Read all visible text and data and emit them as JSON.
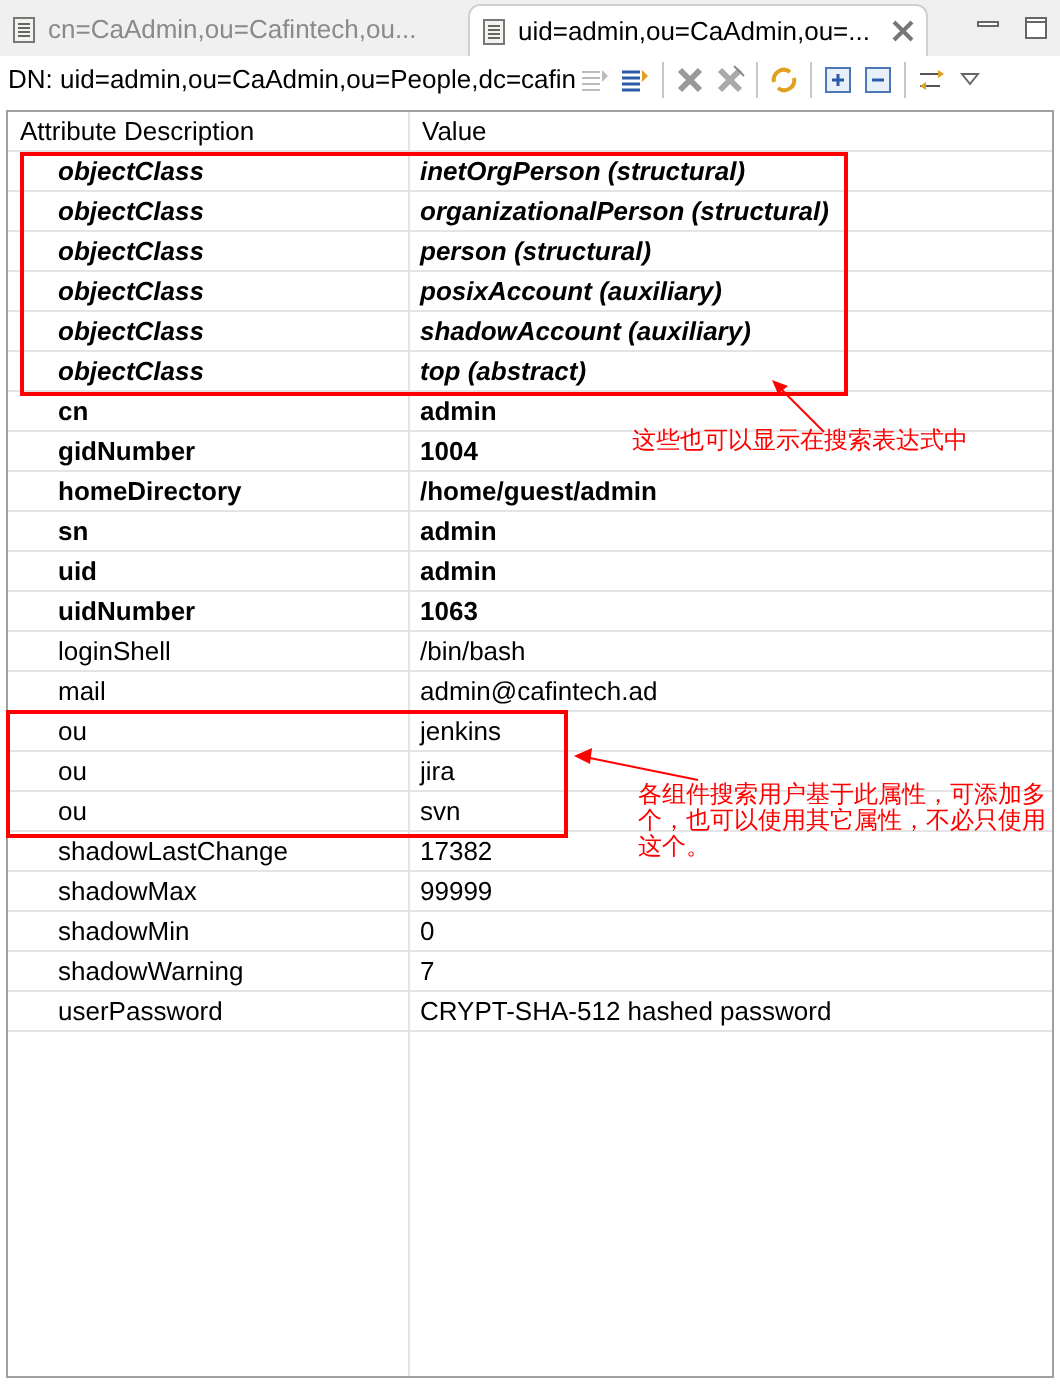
{
  "tabs": [
    {
      "label": "cn=CaAdmin,ou=Cafintech,ou...",
      "selected": false
    },
    {
      "label": "uid=admin,ou=CaAdmin,ou=...",
      "selected": true
    }
  ],
  "dn": "DN: uid=admin,ou=CaAdmin,ou=People,dc=cafin",
  "table": {
    "columns": [
      "Attribute Description",
      "Value"
    ],
    "rows": [
      {
        "kind": "objectclass",
        "attribute": "objectClass",
        "value": "inetOrgPerson (structural)"
      },
      {
        "kind": "objectclass",
        "attribute": "objectClass",
        "value": "organizationalPerson (structural)"
      },
      {
        "kind": "objectclass",
        "attribute": "objectClass",
        "value": "person (structural)"
      },
      {
        "kind": "objectclass",
        "attribute": "objectClass",
        "value": "posixAccount (auxiliary)"
      },
      {
        "kind": "objectclass",
        "attribute": "objectClass",
        "value": "shadowAccount (auxiliary)"
      },
      {
        "kind": "objectclass",
        "attribute": "objectClass",
        "value": "top (abstract)"
      },
      {
        "kind": "must",
        "attribute": "cn",
        "value": "admin"
      },
      {
        "kind": "must",
        "attribute": "gidNumber",
        "value": "1004"
      },
      {
        "kind": "must",
        "attribute": "homeDirectory",
        "value": "/home/guest/admin"
      },
      {
        "kind": "must",
        "attribute": "sn",
        "value": "admin"
      },
      {
        "kind": "must",
        "attribute": "uid",
        "value": "admin"
      },
      {
        "kind": "must",
        "attribute": "uidNumber",
        "value": "1063"
      },
      {
        "kind": "may",
        "attribute": "loginShell",
        "value": "/bin/bash"
      },
      {
        "kind": "may",
        "attribute": "mail",
        "value": "admin@cafintech.ad"
      },
      {
        "kind": "may",
        "attribute": "ou",
        "value": "jenkins"
      },
      {
        "kind": "may",
        "attribute": "ou",
        "value": "jira"
      },
      {
        "kind": "may",
        "attribute": "ou",
        "value": "svn"
      },
      {
        "kind": "may",
        "attribute": "shadowLastChange",
        "value": "17382"
      },
      {
        "kind": "may",
        "attribute": "shadowMax",
        "value": "99999"
      },
      {
        "kind": "may",
        "attribute": "shadowMin",
        "value": "0"
      },
      {
        "kind": "may",
        "attribute": "shadowWarning",
        "value": "7"
      },
      {
        "kind": "may",
        "attribute": "userPassword",
        "value": "CRYPT-SHA-512 hashed password"
      }
    ]
  },
  "annotations": [
    {
      "text": "这些也可以显示在搜索表达式中"
    },
    {
      "text": "各组件搜索用户基于此属性，可添加多个，也可以使用其它属性，不必只使用这个。"
    }
  ]
}
